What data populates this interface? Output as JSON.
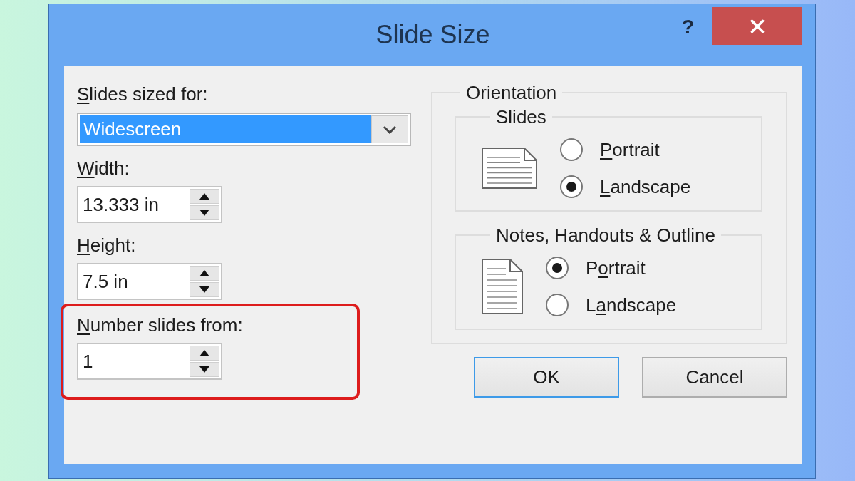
{
  "window": {
    "title": "Slide Size",
    "help": "?"
  },
  "sized_for": {
    "label": {
      "key": "S",
      "post": "lides sized for:"
    },
    "value": "Widescreen",
    "focused": true
  },
  "fields": [
    {
      "label": {
        "key": "W",
        "post": "idth:"
      },
      "value": "13.333 in",
      "highlighted": false
    },
    {
      "label": {
        "key": "H",
        "post": "eight:"
      },
      "value": "7.5 in",
      "highlighted": false
    },
    {
      "label": {
        "key": "N",
        "post": "umber slides from:"
      },
      "value": "1",
      "highlighted": true
    }
  ],
  "orientation": {
    "title": "Orientation",
    "groups": [
      {
        "title": "Slides",
        "options": [
          {
            "label": {
              "key": "P",
              "post": "ortrait"
            },
            "selected": false
          },
          {
            "label": {
              "key": "L",
              "post": "andscape"
            },
            "selected": true
          }
        ]
      },
      {
        "title": "Notes, Handouts & Outline",
        "options": [
          {
            "label": {
              "pre": "P",
              "key": "o",
              "post": "rtrait"
            },
            "selected": true
          },
          {
            "label": {
              "pre": "L",
              "key": "a",
              "post": "ndscape"
            },
            "selected": false
          }
        ]
      }
    ]
  },
  "buttons": [
    {
      "label": "OK",
      "default": true
    },
    {
      "label": "Cancel",
      "default": false
    }
  ]
}
